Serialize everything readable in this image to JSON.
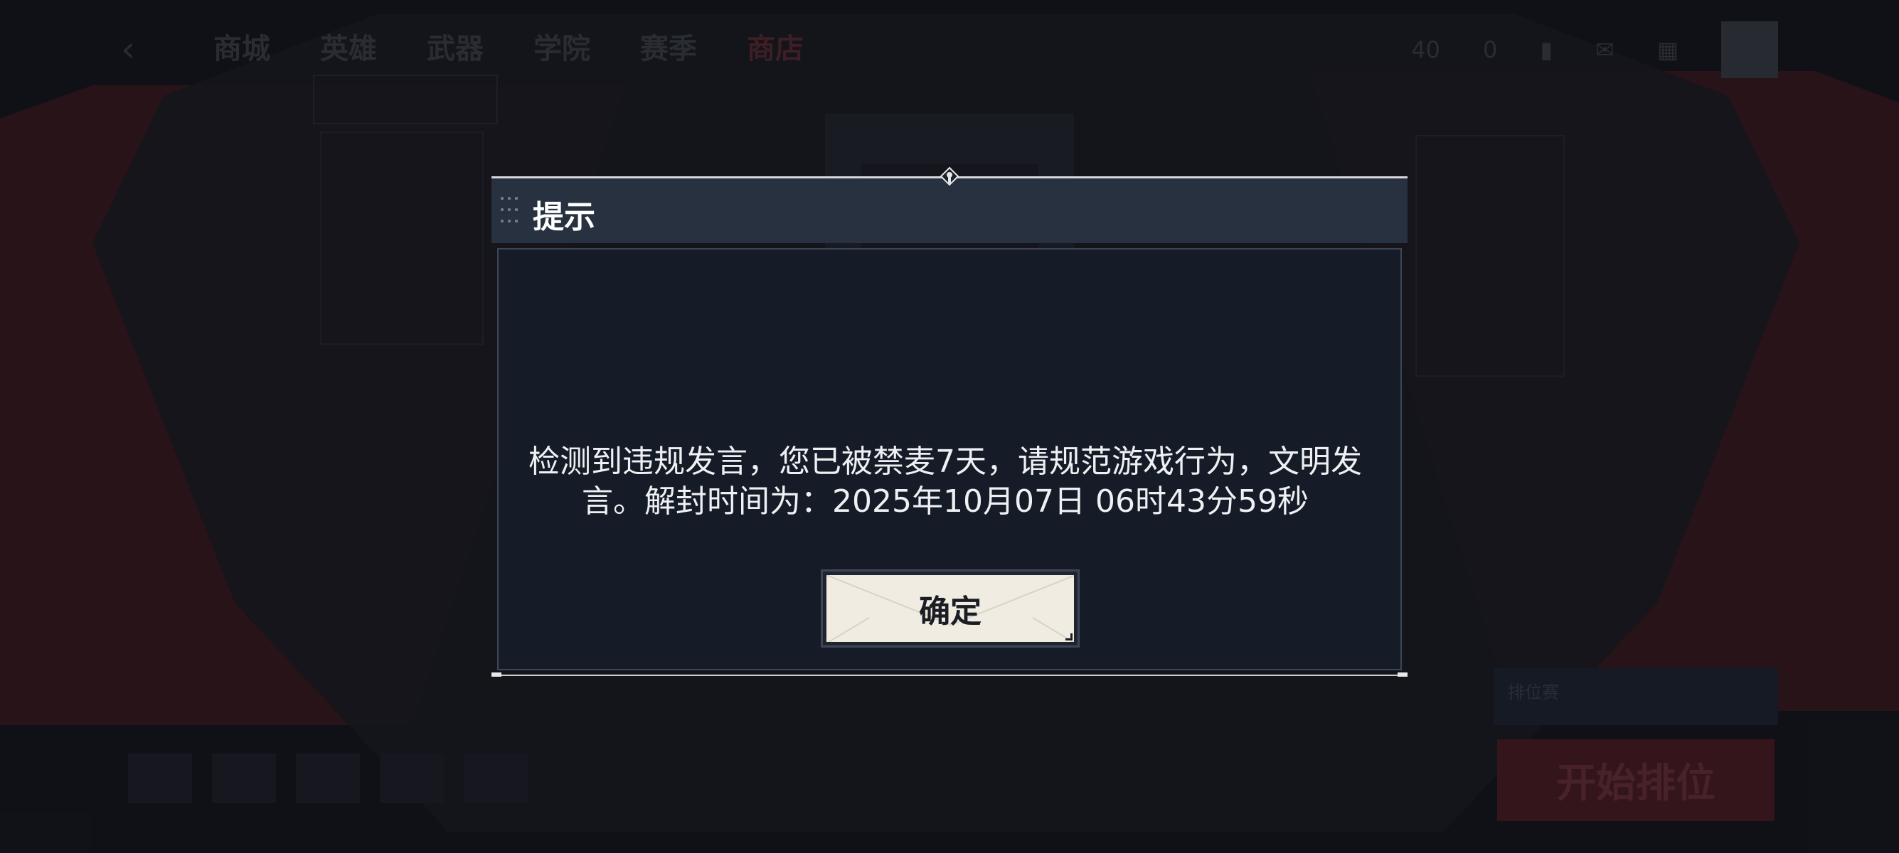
{
  "background": {
    "nav": {
      "back_icon": "back-arrow-icon",
      "items": [
        "商城",
        "英雄",
        "武器",
        "学院",
        "赛季",
        "商店"
      ]
    },
    "top_right": {
      "stat1": "40",
      "stat2": "0"
    },
    "bottom_bar": {
      "start_label": "开始排位",
      "rank_label": "排位赛"
    }
  },
  "dialog": {
    "title": "提示",
    "message": "检测到违规发言，您已被禁麦7天，请规范游戏行为，文明发言。解封时间为：2025年10月07日 06时43分59秒",
    "confirm_label": "确定"
  },
  "colors": {
    "header_bg": "#27313f",
    "body_bg": "#161c27",
    "button_bg": "#f0ece2",
    "accent_red": "#3a1a1e"
  }
}
